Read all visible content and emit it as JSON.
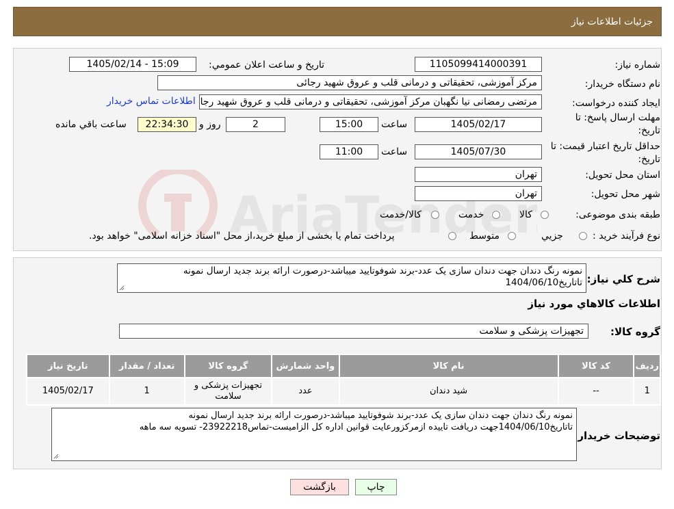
{
  "header": {
    "title": "جزئیات اطلاعات نیاز"
  },
  "watermark": {
    "text": "AriaTender.neT"
  },
  "form": {
    "need_number_label": "شماره نیاز:",
    "need_number": "1105099414000391",
    "announce_label": "تاریخ و ساعت اعلان عمومي:",
    "announce_value": "1405/02/14 - 15:09",
    "buyer_org_label": "نام دستگاه خریدار:",
    "buyer_org": "مرکز آموزشی، تحقیقاتی و درمانی قلب و عروق شهید رجائی",
    "creator_label": "ایجاد کننده درخواست:",
    "creator": "مرتضی رمضانی نیا نگهبان مرکز آموزشی، تحقیقاتی و درمانی قلب و عروق شهید رجائی",
    "contact_link": "اطلاعات تماس خریدار",
    "deadline_label_1": "مهلت ارسال پاسخ: تا",
    "deadline_label_2": "تاریخ:",
    "deadline_date": "1405/02/17",
    "time_label": "ساعت",
    "deadline_time": "15:00",
    "days_value": "2",
    "days_label": "روز و",
    "remaining_time": "22:34:30",
    "remaining_label": "ساعت باقي مانده",
    "validity_label_1": "حداقل تاریخ اعتبار قیمت: تا",
    "validity_label_2": "تاریخ:",
    "validity_date": "1405/07/30",
    "validity_time": "11:00",
    "province_label": "استان محل تحویل:",
    "province": "تهران",
    "city_label": "شهر محل تحویل:",
    "city": "تهران",
    "category_label": "طبقه بندی موضوعی:",
    "category_options": [
      "کالا",
      "خدمت",
      "کالا/خدمت"
    ],
    "process_label": "نوع فرآیند خرید :",
    "process_options": [
      "جزيي",
      "متوسط"
    ],
    "process_note": "پرداخت تمام یا بخشی از مبلغ خرید،از محل \"اسناد خزانه اسلامی\" خواهد بود."
  },
  "summary": {
    "label": "شرح کلي نياز:",
    "text": "نمونه رنگ دندان جهت دندان سازی یک عدد-برند شوفوتایید میباشد-درصورت ارائه برند جدید ارسال نمونه تاتاریخ1404/06/10"
  },
  "goods_section": {
    "title": "اطلاعات کالاهاي مورد نياز",
    "group_label": "گروه کالا:",
    "group_value": "تجهیزات پزشکی و سلامت"
  },
  "table": {
    "headers": [
      "رديف",
      "کد کالا",
      "نام کالا",
      "واحد شمارش",
      "گروه کالا",
      "تعداد / مقدار",
      "تاریخ نیاز"
    ],
    "rows": [
      [
        "1",
        "--",
        "شید دندان",
        "عدد",
        "تجهیزات پزشکی و سلامت",
        "1",
        "1405/02/17"
      ]
    ]
  },
  "buyer_notes": {
    "label": "توضيحات خريدار:",
    "line1": "نمونه رنگ دندان جهت دندان سازی یک عدد-برند شوفوتایید میباشد-درصورت ارائه برند جدید ارسال نمونه",
    "line2": "تاتاریخ1404/06/10جهت دریافت تاییده ازمرکزورعایت قوانین اداره کل الزامیست-تماس23922218- تسویه سه ماهه"
  },
  "buttons": {
    "print": "چاپ",
    "back": "بازگشت"
  },
  "colors": {
    "header_bg": "#8b6d3f",
    "table_header": "#9b9b9b",
    "field_highlight": "#ffffcc",
    "back_button": "#ffe0e0",
    "print_button": "#e6ffe6",
    "link": "#1a3bd1"
  }
}
